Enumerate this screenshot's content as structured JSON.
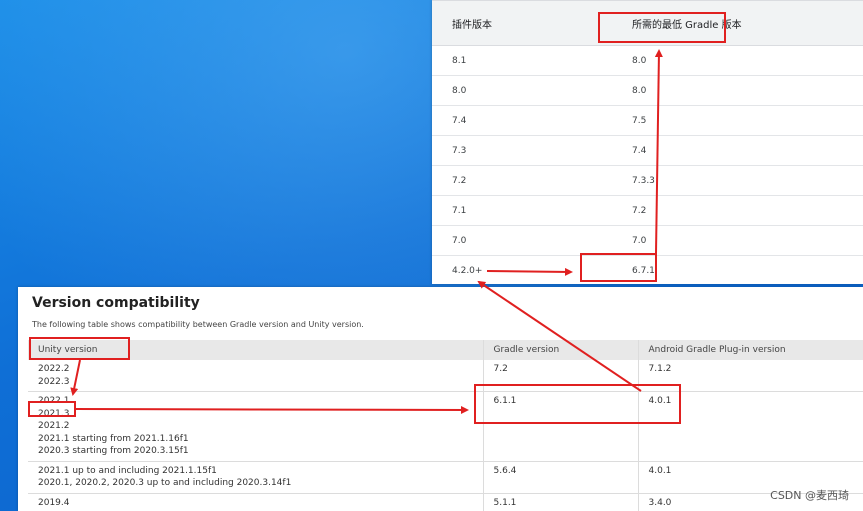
{
  "plugin_table": {
    "headers": [
      "插件版本",
      "所需的最低 Gradle 版本"
    ],
    "rows": [
      [
        "8.1",
        "8.0"
      ],
      [
        "8.0",
        "8.0"
      ],
      [
        "7.4",
        "7.5"
      ],
      [
        "7.3",
        "7.4"
      ],
      [
        "7.2",
        "7.3.3"
      ],
      [
        "7.1",
        "7.2"
      ],
      [
        "7.0",
        "7.0"
      ],
      [
        "4.2.0+",
        "6.7.1"
      ]
    ]
  },
  "unity_doc": {
    "title": "Version compatibility",
    "description": "The following table shows compatibility between Gradle version and Unity version.",
    "headers": [
      "Unity version",
      "Gradle version",
      "Android Gradle Plug-in version"
    ],
    "rows": [
      {
        "unity": [
          "2022.2",
          "2022.3"
        ],
        "gradle": "7.2",
        "plugin": "7.1.2"
      },
      {
        "unity": [
          "2022.1",
          "2021.3",
          "2021.2",
          "2021.1 starting from 2021.1.16f1",
          "2020.3 starting from 2020.3.15f1"
        ],
        "gradle": "6.1.1",
        "plugin": "4.0.1"
      },
      {
        "unity": [
          "2021.1 up to and including 2021.1.15f1",
          "2020.1, 2020.2, 2020.3 up to and including 2020.3.14f1"
        ],
        "gradle": "5.6.4",
        "plugin": "4.0.1"
      },
      {
        "unity": [
          "2019.4"
        ],
        "gradle": "5.1.1",
        "plugin": "3.4.0"
      }
    ]
  },
  "annotation_color": "#e02020",
  "watermark": "CSDN @麦西琦"
}
